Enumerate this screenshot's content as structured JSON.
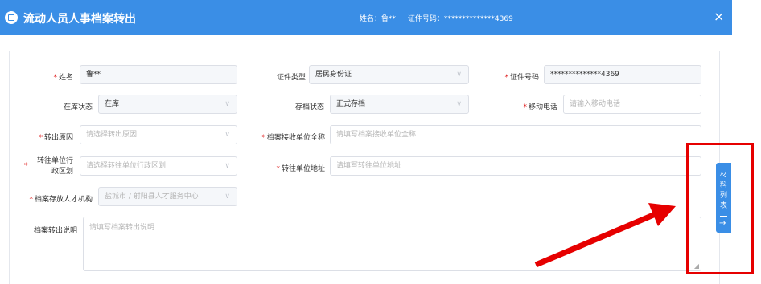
{
  "header": {
    "title": "流动人员人事档案转出",
    "name_label": "姓名：鲁**",
    "id_label": "证件号码：**************4369",
    "close_symbol": "×"
  },
  "form": {
    "name": {
      "label": "姓名",
      "value": "鲁**"
    },
    "id_type": {
      "label": "证件类型",
      "value": "居民身份证"
    },
    "id_no": {
      "label": "证件号码",
      "value": "**************4369"
    },
    "storage_status": {
      "label": "在库状态",
      "value": "在库"
    },
    "archive_status": {
      "label": "存档状态",
      "value": "正式存档"
    },
    "mobile": {
      "label": "移动电话",
      "placeholder": "请输入移动电话"
    },
    "reason": {
      "label": "转出原因",
      "placeholder": "请选择转出原因"
    },
    "receiver": {
      "label": "档案接收单位全称",
      "placeholder": "请填写档案接收单位全称"
    },
    "region": {
      "label_line1": "转往单位行",
      "label_line2": "政区划",
      "placeholder": "请选择转往单位行政区划"
    },
    "address": {
      "label": "转往单位地址",
      "placeholder": "请填写转往单位地址"
    },
    "agency": {
      "label": "档案存放人才机构",
      "value": "盐城市 / 射阳县人才服务中心"
    },
    "note": {
      "label": "档案转出说明",
      "placeholder": "请填写档案转出说明"
    }
  },
  "side_tab": {
    "chars": [
      "材",
      "料",
      "列",
      "表"
    ],
    "go_symbol": "→"
  },
  "colors": {
    "primary": "#3a8ee6",
    "annotation_red": "#e60000",
    "required": "#e02020"
  }
}
